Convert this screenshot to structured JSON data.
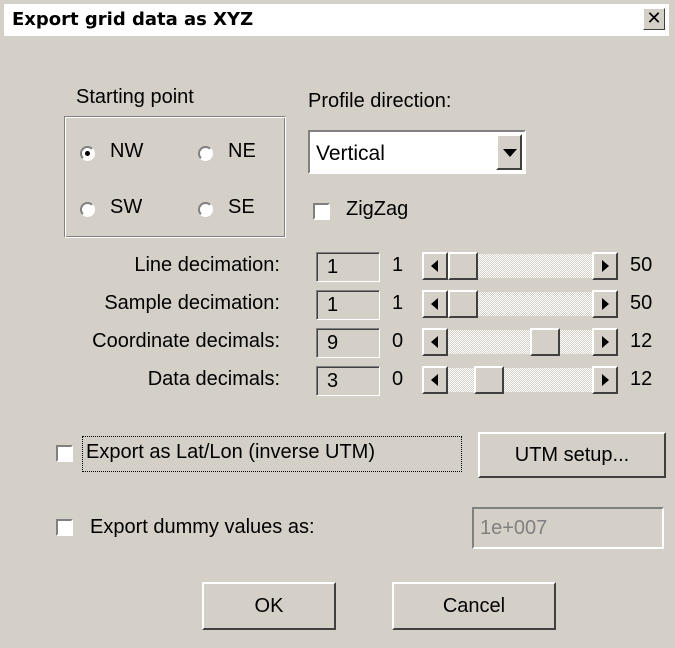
{
  "window": {
    "title": "Export grid data as XYZ",
    "close_glyph": "✕"
  },
  "starting_point": {
    "label": "Starting point",
    "options": [
      {
        "label": "NW",
        "selected": true
      },
      {
        "label": "NE",
        "selected": false
      },
      {
        "label": "SW",
        "selected": false
      },
      {
        "label": "SE",
        "selected": false
      }
    ]
  },
  "profile_direction": {
    "label": "Profile direction:",
    "value": "Vertical"
  },
  "zigzag": {
    "label": "ZigZag",
    "checked": false
  },
  "sliders": [
    {
      "label": "Line decimation:",
      "value": "1",
      "min": "1",
      "max": "50"
    },
    {
      "label": "Sample decimation:",
      "value": "1",
      "min": "1",
      "max": "50"
    },
    {
      "label": "Coordinate decimals:",
      "value": "9",
      "min": "0",
      "max": "12"
    },
    {
      "label": "Data decimals:",
      "value": "3",
      "min": "0",
      "max": "12"
    }
  ],
  "export_latlon": {
    "label": "Export as Lat/Lon (inverse UTM)",
    "checked": false
  },
  "utm_setup": {
    "label": "UTM setup..."
  },
  "export_dummy": {
    "label": "Export dummy values as:",
    "checked": false,
    "value": "1e+007"
  },
  "buttons": {
    "ok": "OK",
    "cancel": "Cancel"
  }
}
